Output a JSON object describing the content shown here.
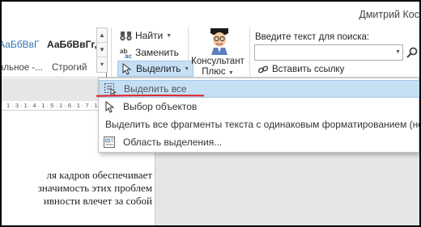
{
  "title_bar": {
    "user_name": "Дмитрий Кос"
  },
  "ribbon": {
    "styles": [
      {
        "sample": "АаБбВвГ",
        "label": "альное -..."
      },
      {
        "sample": "АаБбВвГг,",
        "label": "Строгий"
      }
    ],
    "editing": {
      "find_label": "Найти",
      "replace_label": "Заменить",
      "select_label": "Выделить"
    },
    "consultant": {
      "label_line1": "Консультант",
      "label_line2": "Плюс"
    },
    "search": {
      "label": "Введите текст для поиска:",
      "value": "",
      "placeholder": ""
    },
    "insert_link_label": "Вставить ссылку"
  },
  "ruler": {
    "text": "1 · 3 · 1 · 4 · 1 · 5 · 1 · 6 · 1 · 7 · 1"
  },
  "document": {
    "lines": [
      "ля кадров обеспечивает",
      "значимость этих проблем",
      "ивности влечет за собой"
    ]
  },
  "select_menu": {
    "items": [
      {
        "label": "Выделить все",
        "icon": "select-all-icon"
      },
      {
        "label": "Выбор объектов",
        "icon": "cursor-arrow-icon"
      },
      {
        "label": "Выделить все фрагменты текста с одинаковым форматированием (нет",
        "icon": ""
      },
      {
        "label": "Область выделения...",
        "icon": "selection-pane-icon"
      }
    ]
  },
  "colors": {
    "style_sample_blue": "#2e74b5",
    "highlight": "#c5dff5",
    "highlight_border": "#a3c8ea",
    "annotation_red": "#e02020"
  }
}
